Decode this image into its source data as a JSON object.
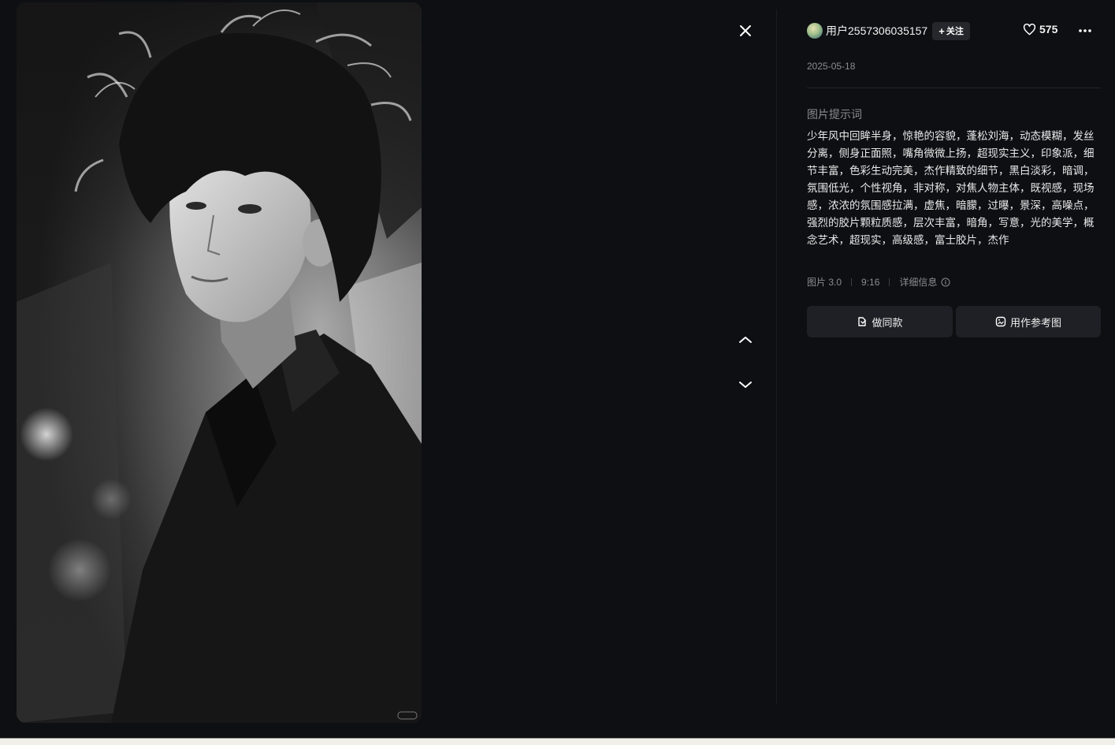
{
  "author": {
    "username": "用户2557306035157",
    "follow_label": "关注",
    "avatar_icon": "avatar-image"
  },
  "likes": {
    "count": "575",
    "icon": "heart-icon"
  },
  "more_icon": "more-dots-icon",
  "date": "2025-05-18",
  "prompt": {
    "title": "图片提示词",
    "text": "少年风中回眸半身，惊艳的容貌，蓬松刘海，动态模糊，发丝分离，侧身正面照，嘴角微微上扬，超现实主义，印象派，细节丰富，色彩生动完美，杰作精致的细节，黑白淡彩，暗调，氛围低光，个性视角，非对称，对焦人物主体，既视感，现场感，浓浓的氛围感拉满，虚焦，暗朦，过曝，景深，高噪点，强烈的胶片颗粒质感，层次丰富，暗角，写意，光的美学，概念艺术，超现实，高级感，富士胶片，杰作"
  },
  "meta": {
    "model": "图片 3.0",
    "ratio": "9:16",
    "detail_label": "详细信息"
  },
  "actions": {
    "make_same": "做同款",
    "use_as_reference": "用作参考图"
  },
  "navigation": {
    "close_icon": "close-icon",
    "prev_icon": "chevron-up-icon",
    "next_icon": "chevron-down-icon"
  },
  "image": {
    "description_icon": "generated-portrait-image",
    "palette": {
      "background": "#0e0f12",
      "panel_button": "#1e2025",
      "muted_text": "#8a8c93"
    }
  }
}
